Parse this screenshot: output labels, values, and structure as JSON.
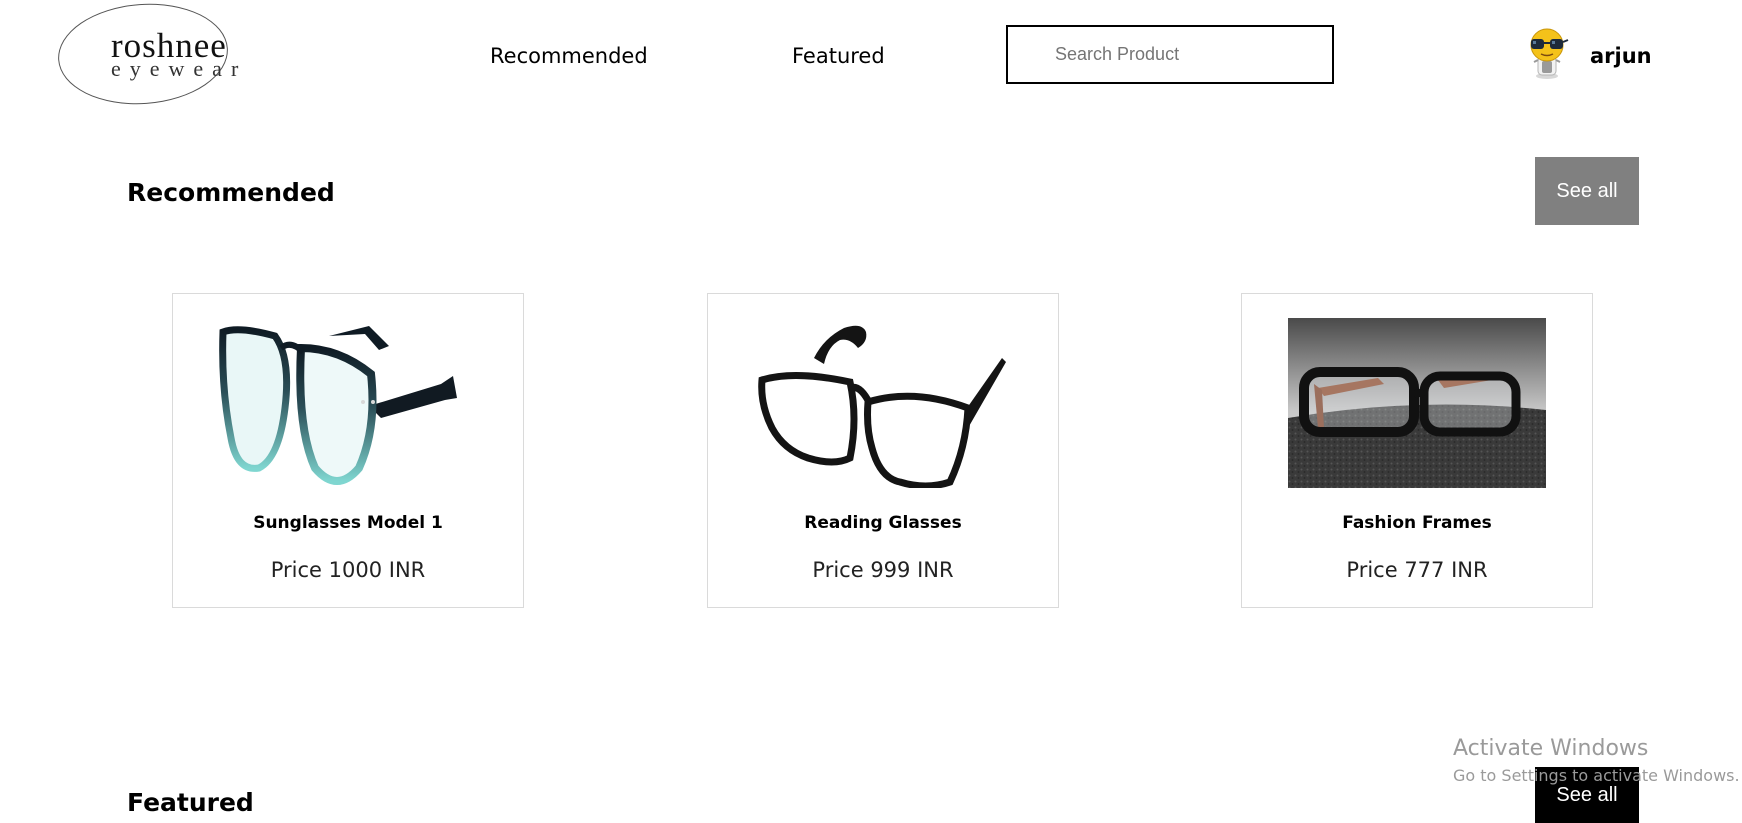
{
  "header": {
    "logo": {
      "main": "roshnee",
      "sub": "eyewear"
    },
    "nav": [
      {
        "label": "Recommended"
      },
      {
        "label": "Featured"
      }
    ],
    "search": {
      "placeholder": "Search Product",
      "value": ""
    },
    "user": {
      "name": "arjun",
      "avatar_icon": "emoji-avatar-with-glasses"
    }
  },
  "recommended": {
    "title": "Recommended",
    "see_all_label": "See all",
    "products": [
      {
        "name": "Sunglasses Model 1",
        "price": "Price 1000 INR",
        "image": "teal-gradient-round-glasses"
      },
      {
        "name": "Reading Glasses",
        "price": "Price 999 INR",
        "image": "black-rectangular-glasses"
      },
      {
        "name": "Fashion Frames",
        "price": "Price 777 INR",
        "image": "black-frames-on-carpet-photo"
      }
    ]
  },
  "featured": {
    "title": "Featured",
    "see_all_label": "See all"
  },
  "watermark": {
    "line1": "Activate Windows",
    "line2": "Go to Settings to activate Windows."
  },
  "colors": {
    "see_all_recommended_bg": "#808080",
    "see_all_featured_bg": "#000000",
    "card_border": "#dadada",
    "text": "#000000"
  }
}
